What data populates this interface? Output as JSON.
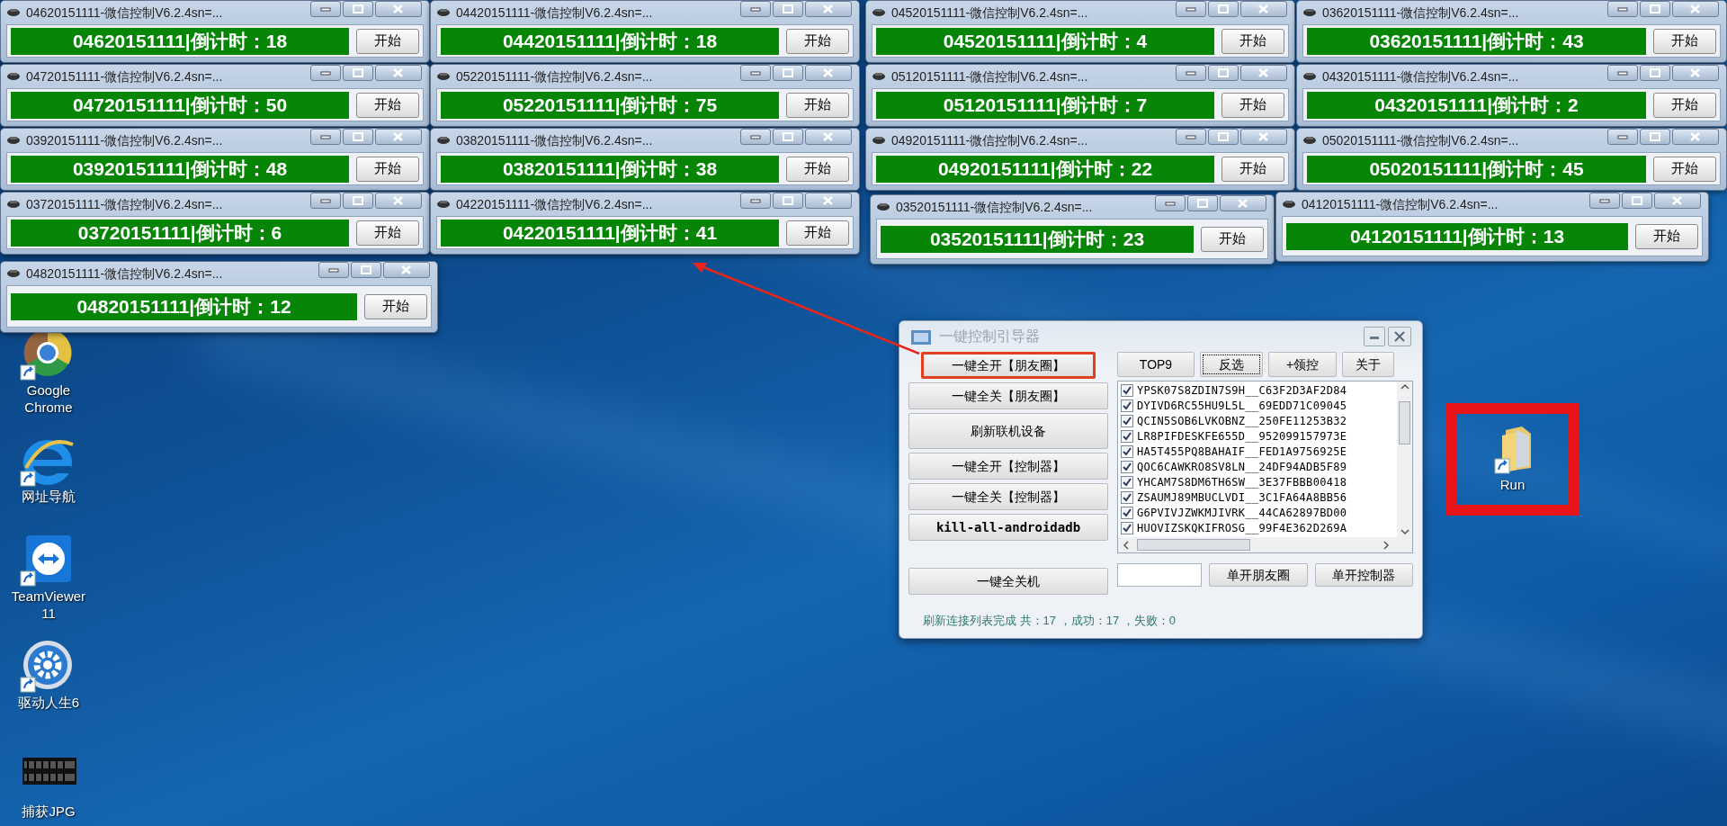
{
  "counter_windows": [
    {
      "title": "04620151111-微信控制V6.2.4sn=...",
      "counter": "04620151111|倒计时：18",
      "button": "开始"
    },
    {
      "title": "04420151111-微信控制V6.2.4sn=...",
      "counter": "04420151111|倒计时：18",
      "button": "开始"
    },
    {
      "title": "04520151111-微信控制V6.2.4sn=...",
      "counter": "04520151111|倒计时：4",
      "button": "开始"
    },
    {
      "title": "03620151111-微信控制V6.2.4sn=...",
      "counter": "03620151111|倒计时：43",
      "button": "开始"
    },
    {
      "title": "04720151111-微信控制V6.2.4sn=...",
      "counter": "04720151111|倒计时：50",
      "button": "开始"
    },
    {
      "title": "05220151111-微信控制V6.2.4sn=...",
      "counter": "05220151111|倒计时：75",
      "button": "开始"
    },
    {
      "title": "05120151111-微信控制V6.2.4sn=...",
      "counter": "05120151111|倒计时：7",
      "button": "开始"
    },
    {
      "title": "04320151111-微信控制V6.2.4sn=...",
      "counter": "04320151111|倒计时：2",
      "button": "开始"
    },
    {
      "title": "03920151111-微信控制V6.2.4sn=...",
      "counter": "03920151111|倒计时：48",
      "button": "开始"
    },
    {
      "title": "03820151111-微信控制V6.2.4sn=...",
      "counter": "03820151111|倒计时：38",
      "button": "开始"
    },
    {
      "title": "04920151111-微信控制V6.2.4sn=...",
      "counter": "04920151111|倒计时：22",
      "button": "开始"
    },
    {
      "title": "05020151111-微信控制V6.2.4sn=...",
      "counter": "05020151111|倒计时：45",
      "button": "开始"
    },
    {
      "title": "03720151111-微信控制V6.2.4sn=...",
      "counter": "03720151111|倒计时：6",
      "button": "开始"
    },
    {
      "title": "04220151111-微信控制V6.2.4sn=...",
      "counter": "04220151111|倒计时：41",
      "button": "开始"
    },
    {
      "title": "03520151111-微信控制V6.2.4sn=...",
      "counter": "03520151111|倒计时：23",
      "button": "开始"
    },
    {
      "title": "04120151111-微信控制V6.2.4sn=...",
      "counter": "04120151111|倒计时：13",
      "button": "开始"
    },
    {
      "title": "04820151111-微信控制V6.2.4sn=...",
      "counter": "04820151111|倒计时：12",
      "button": "开始"
    }
  ],
  "desktop_icons": [
    {
      "label": "Google Chrome",
      "kind": "chrome"
    },
    {
      "label": "网址导航",
      "kind": "browser"
    },
    {
      "label": "TeamViewer 11",
      "kind": "remote"
    },
    {
      "label": "驱动人生6",
      "kind": "gear"
    },
    {
      "label": "捕获JPG",
      "kind": "image"
    }
  ],
  "run_shortcut": {
    "label": "Run",
    "highlighted": true
  },
  "dialog": {
    "title": "一键控制引导器",
    "left_buttons": [
      {
        "label": "一键全开【朋友圈】",
        "highlighted": true
      },
      {
        "label": "一键全关【朋友圈】",
        "highlighted": false
      },
      {
        "label": "刷新联机设备",
        "highlighted": false
      },
      {
        "label": "一键全开【控制器】",
        "highlighted": false
      },
      {
        "label": "一键全关【控制器】",
        "highlighted": false
      },
      {
        "label": "kill-all-androidadb",
        "highlighted": false
      }
    ],
    "shutdown_button": "一键全关机",
    "top_buttons": [
      {
        "label": "TOP9",
        "focused": false
      },
      {
        "label": "反选",
        "focused": true
      },
      {
        "label": "+领控",
        "focused": false
      },
      {
        "label": "关于",
        "focused": false
      }
    ],
    "devices": [
      {
        "text": "YPSK07S8ZDIN7S9H__C63F2D3AF2D84",
        "checked": true
      },
      {
        "text": "DYIVD6RC55HU9L5L__69EDD71C09045",
        "checked": true
      },
      {
        "text": "QCIN5SOB6LVKOBNZ__250FE11253B32",
        "checked": true
      },
      {
        "text": "LR8PIFDESKFE655D__952099157973E",
        "checked": true
      },
      {
        "text": "HA5T455PQ8BAHAIF__FED1A9756925E",
        "checked": true
      },
      {
        "text": "QOC6CAWKRO8SV8LN__24DF94ADB5F89",
        "checked": true
      },
      {
        "text": "YHCAM7S8DM6TH6SW__3E37FBBB00418",
        "checked": true
      },
      {
        "text": "ZSAUMJ89MBUCLVDI__3C1FA64A8BB56",
        "checked": true
      },
      {
        "text": "G6PVIVJZWKMJIVRK__44CA62897BD00",
        "checked": true
      },
      {
        "text": "HUOVIZSKQKIFROSG__99F4E362D269A",
        "checked": true
      }
    ],
    "bottom_buttons": [
      "单开朋友圈",
      "单开控制器"
    ],
    "status": "刷新连接列表完成 共：17 ，成功：17 ，失败：0"
  }
}
